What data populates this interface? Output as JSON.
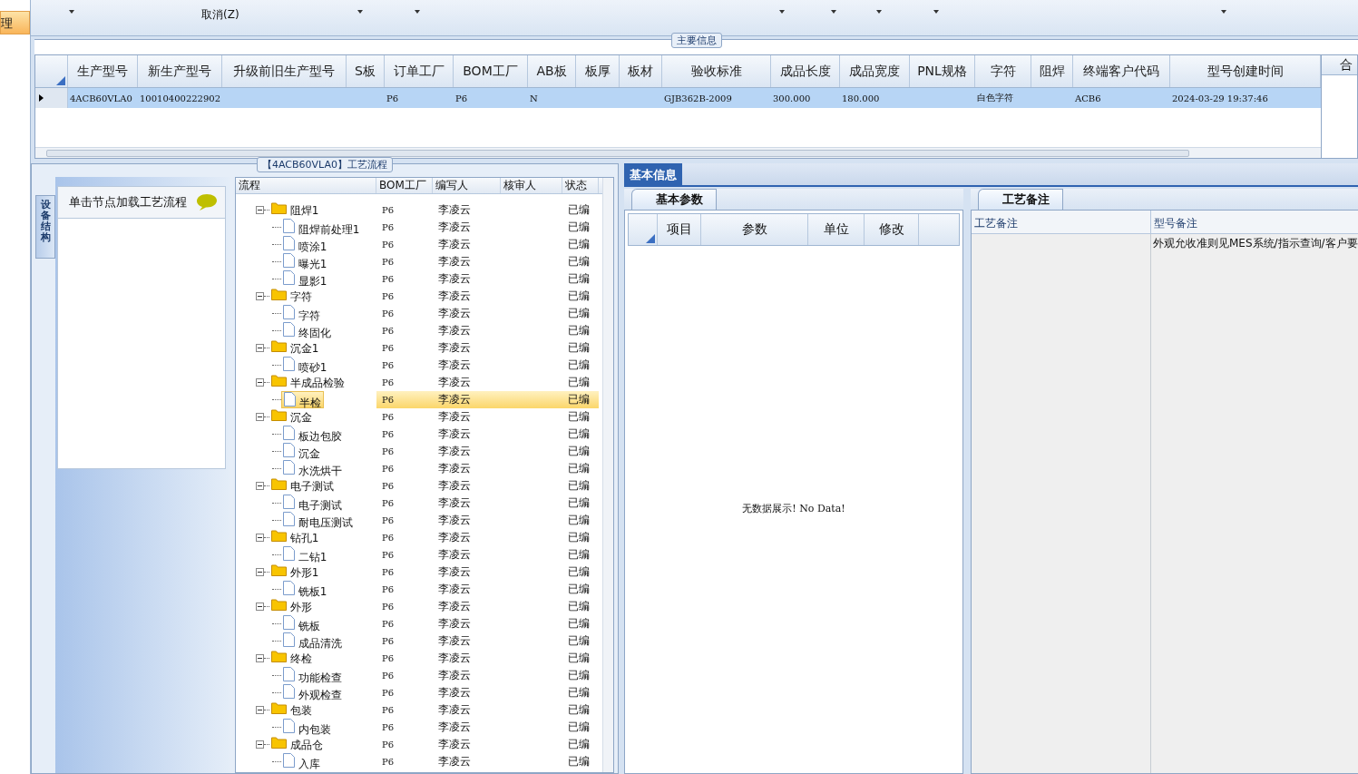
{
  "sidebar": {
    "items": [
      {
        "label": "理",
        "selected": true
      }
    ]
  },
  "toolbar": {
    "cancel": "取消(Z)"
  },
  "main_info": {
    "title": "主要信息",
    "columns": [
      "生产型号",
      "新生产型号",
      "升级前旧生产型号",
      "S板",
      "订单工厂",
      "BOM工厂",
      "AB板",
      "板厚",
      "板材",
      "验收标准",
      "成品长度",
      "成品宽度",
      "PNL规格",
      "字符",
      "阻焊",
      "终端客户代码",
      "型号创建时间"
    ],
    "rows": [
      {
        "selected": true,
        "cells": [
          "4ACB60VLA0",
          "10010400222902",
          "",
          "",
          "P6",
          "P6",
          "N",
          "",
          "",
          "GJB362B-2009",
          "300.000",
          "180.000",
          "",
          "白色字符",
          "",
          "ACB6",
          "2024-03-29 19:37:46"
        ]
      }
    ],
    "side_column": "合"
  },
  "process": {
    "title": "【4ACB60VLA0】工艺流程",
    "vertical_tab": "设备结构",
    "hint": "单击节点加载工艺流程",
    "columns": [
      "流程",
      "BOM工厂",
      "编写人",
      "核审人",
      "状态"
    ],
    "tree": [
      {
        "name": "阻焊1",
        "bom": "P6",
        "writer": "李凌云",
        "status": "已编",
        "selected": false,
        "children": [
          {
            "name": "阻焊前处理1",
            "bom": "P6",
            "writer": "李凌云",
            "status": "已编",
            "selected": false
          },
          {
            "name": "喷涂1",
            "bom": "P6",
            "writer": "李凌云",
            "status": "已编",
            "selected": false
          },
          {
            "name": "曝光1",
            "bom": "P6",
            "writer": "李凌云",
            "status": "已编",
            "selected": false
          },
          {
            "name": "显影1",
            "bom": "P6",
            "writer": "李凌云",
            "status": "已编",
            "selected": false
          }
        ]
      },
      {
        "name": "字符",
        "bom": "P6",
        "writer": "李凌云",
        "status": "已编",
        "selected": false,
        "children": [
          {
            "name": "字符",
            "bom": "P6",
            "writer": "李凌云",
            "status": "已编",
            "selected": false
          },
          {
            "name": "终固化",
            "bom": "P6",
            "writer": "李凌云",
            "status": "已编",
            "selected": false
          }
        ]
      },
      {
        "name": "沉金1",
        "bom": "P6",
        "writer": "李凌云",
        "status": "已编",
        "selected": false,
        "children": [
          {
            "name": "喷砂1",
            "bom": "P6",
            "writer": "李凌云",
            "status": "已编",
            "selected": false
          }
        ]
      },
      {
        "name": "半成品检验",
        "bom": "P6",
        "writer": "李凌云",
        "status": "已编",
        "selected": false,
        "children": [
          {
            "name": "半检",
            "bom": "P6",
            "writer": "李凌云",
            "status": "已编",
            "selected": true
          }
        ]
      },
      {
        "name": "沉金",
        "bom": "P6",
        "writer": "李凌云",
        "status": "已编",
        "selected": false,
        "children": [
          {
            "name": "板边包胶",
            "bom": "P6",
            "writer": "李凌云",
            "status": "已编",
            "selected": false
          },
          {
            "name": "沉金",
            "bom": "P6",
            "writer": "李凌云",
            "status": "已编",
            "selected": false
          },
          {
            "name": "水洗烘干",
            "bom": "P6",
            "writer": "李凌云",
            "status": "已编",
            "selected": false
          }
        ]
      },
      {
        "name": "电子测试",
        "bom": "P6",
        "writer": "李凌云",
        "status": "已编",
        "selected": false,
        "children": [
          {
            "name": "电子测试",
            "bom": "P6",
            "writer": "李凌云",
            "status": "已编",
            "selected": false
          },
          {
            "name": "耐电压测试",
            "bom": "P6",
            "writer": "李凌云",
            "status": "已编",
            "selected": false
          }
        ]
      },
      {
        "name": "钻孔1",
        "bom": "P6",
        "writer": "李凌云",
        "status": "已编",
        "selected": false,
        "children": [
          {
            "name": "二钻1",
            "bom": "P6",
            "writer": "李凌云",
            "status": "已编",
            "selected": false
          }
        ]
      },
      {
        "name": "外形1",
        "bom": "P6",
        "writer": "李凌云",
        "status": "已编",
        "selected": false,
        "children": [
          {
            "name": "铣板1",
            "bom": "P6",
            "writer": "李凌云",
            "status": "已编",
            "selected": false
          }
        ]
      },
      {
        "name": "外形",
        "bom": "P6",
        "writer": "李凌云",
        "status": "已编",
        "selected": false,
        "children": [
          {
            "name": "铣板",
            "bom": "P6",
            "writer": "李凌云",
            "status": "已编",
            "selected": false
          },
          {
            "name": "成品清洗",
            "bom": "P6",
            "writer": "李凌云",
            "status": "已编",
            "selected": false
          }
        ]
      },
      {
        "name": "终检",
        "bom": "P6",
        "writer": "李凌云",
        "status": "已编",
        "selected": false,
        "children": [
          {
            "name": "功能检查",
            "bom": "P6",
            "writer": "李凌云",
            "status": "已编",
            "selected": false
          },
          {
            "name": "外观检查",
            "bom": "P6",
            "writer": "李凌云",
            "status": "已编",
            "selected": false
          }
        ]
      },
      {
        "name": "包装",
        "bom": "P6",
        "writer": "李凌云",
        "status": "已编",
        "selected": false,
        "children": [
          {
            "name": "内包装",
            "bom": "P6",
            "writer": "李凌云",
            "status": "已编",
            "selected": false
          }
        ]
      },
      {
        "name": "成品仓",
        "bom": "P6",
        "writer": "李凌云",
        "status": "已编",
        "selected": false,
        "children": [
          {
            "name": "入库",
            "bom": "P6",
            "writer": "李凌云",
            "status": "已编",
            "selected": false
          }
        ]
      }
    ]
  },
  "detail": {
    "tab": "基本信息",
    "params": {
      "tab": "基本参数",
      "columns": [
        "项目",
        "参数",
        "单位",
        "修改"
      ],
      "empty": "无数据展示! No Data!"
    },
    "notes": {
      "tab": "工艺备注",
      "columns": [
        "工艺备注",
        "型号备注"
      ],
      "model_note": "外观允收准则见MES系统/指示查询/客户要"
    }
  }
}
